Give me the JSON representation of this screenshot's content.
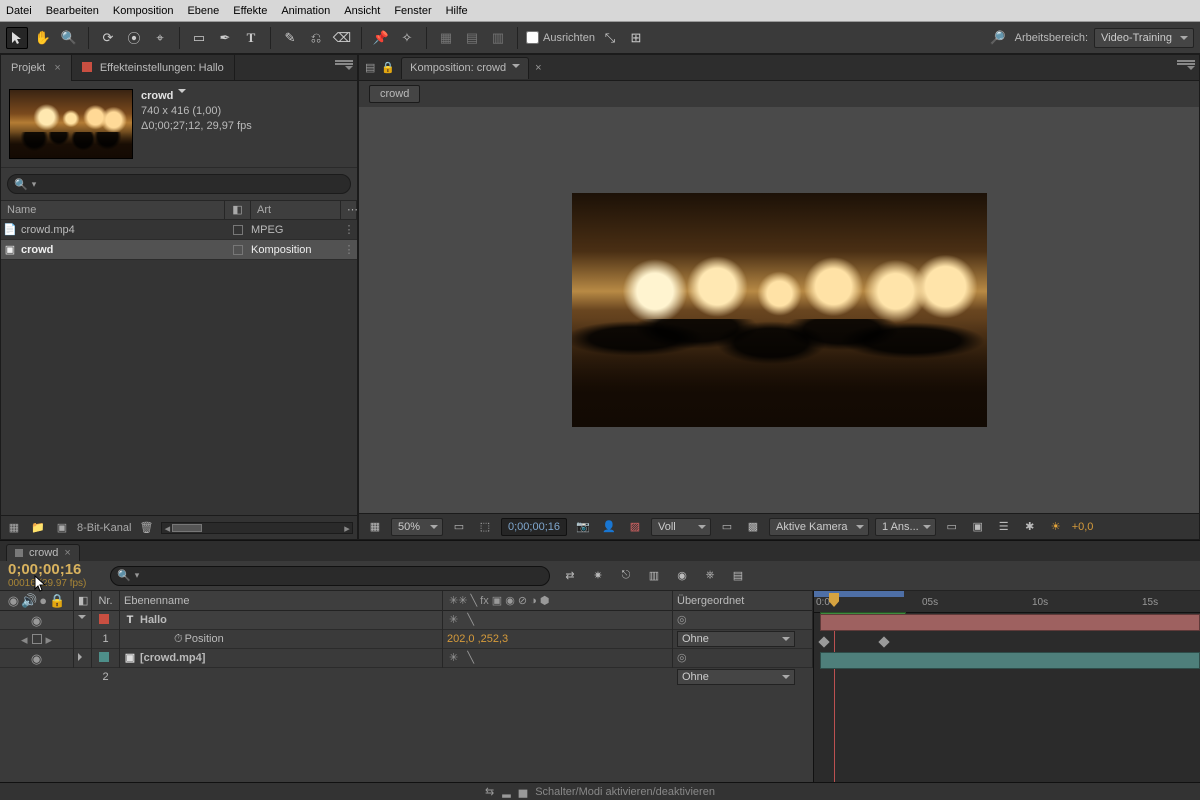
{
  "menu": [
    "Datei",
    "Bearbeiten",
    "Komposition",
    "Ebene",
    "Effekte",
    "Animation",
    "Ansicht",
    "Fenster",
    "Hilfe"
  ],
  "toolbar": {
    "align_label": "Ausrichten",
    "workspace_label": "Arbeitsbereich:",
    "workspace_value": "Video-Training"
  },
  "project_panel": {
    "tab_project": "Projekt",
    "tab_effect": "Effekteinstellungen: Hallo",
    "info": {
      "title": "crowd",
      "dims": "740 x 416 (1,00)",
      "dur": "Δ0;00;27;12, 29,97 fps"
    },
    "columns": {
      "name": "Name",
      "type": "Art"
    },
    "rows": [
      {
        "name": "crowd.mp4",
        "type": "MPEG",
        "selected": false,
        "icon": "📄"
      },
      {
        "name": "crowd",
        "type": "Komposition",
        "selected": true,
        "icon": "▣"
      }
    ],
    "footer": {
      "bpc": "8-Bit-Kanal"
    }
  },
  "comp_panel": {
    "tab_prefix": "Komposition:",
    "tab_name": "crowd",
    "crumb": "crowd",
    "footer": {
      "zoom": "50%",
      "time": "0;00;00;16",
      "quality": "Voll",
      "camera": "Aktive Kamera",
      "views": "1 Ans...",
      "exposure": "+0,0"
    }
  },
  "timeline": {
    "tab": "crowd",
    "timecode": "0;00;00;16",
    "timecode_sub": "00016 (29.97 fps)",
    "columns": {
      "nr": "Nr.",
      "layer": "Ebenenname",
      "parent": "Übergeordnet"
    },
    "layers": [
      {
        "nr": 1,
        "name": "Hallo",
        "label": "red",
        "type": "T",
        "parent": "Ohne",
        "prop": {
          "name": "Position",
          "value": "202,0 ,252,3"
        }
      },
      {
        "nr": 2,
        "name": "[crowd.mp4]",
        "label": "teal",
        "type": "▣",
        "parent": "Ohne"
      }
    ],
    "ruler": {
      "ticks": [
        "0:0",
        "05s",
        "10s",
        "15s"
      ]
    },
    "bottom": "Schalter/Modi aktivieren/deaktivieren"
  }
}
